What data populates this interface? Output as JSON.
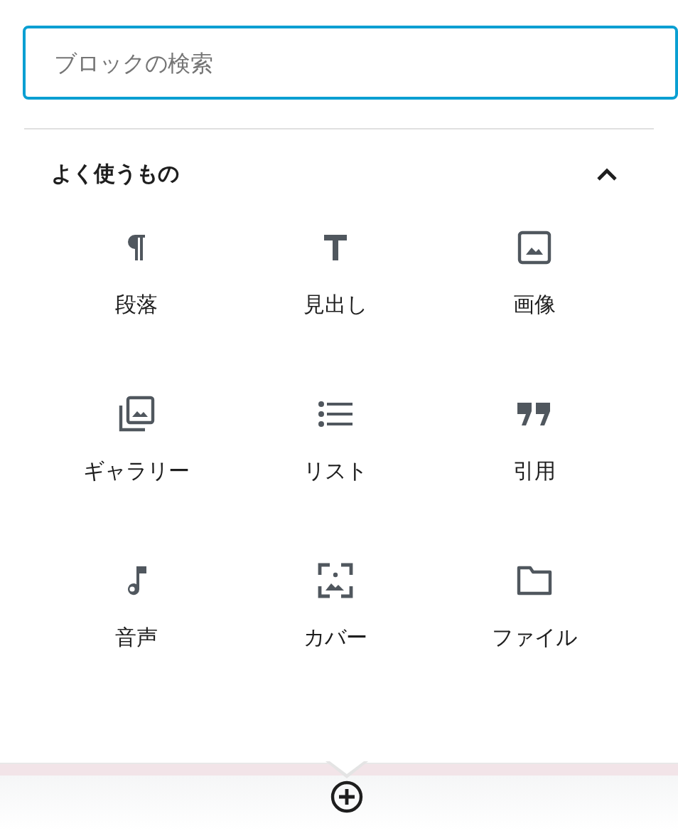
{
  "search": {
    "placeholder": "ブロックの検索"
  },
  "section": {
    "title": "よく使うもの",
    "expanded": true,
    "blocks": [
      {
        "label": "段落"
      },
      {
        "label": "見出し"
      },
      {
        "label": "画像"
      },
      {
        "label": "ギャラリー"
      },
      {
        "label": "リスト"
      },
      {
        "label": "引用"
      },
      {
        "label": "音声"
      },
      {
        "label": "カバー"
      },
      {
        "label": "ファイル"
      }
    ]
  }
}
